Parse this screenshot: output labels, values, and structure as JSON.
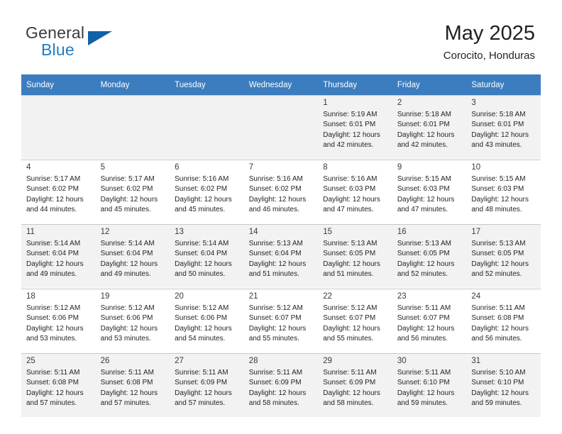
{
  "brand": {
    "line1": "General",
    "line2": "Blue",
    "triangle_icon": "brand-triangle-icon",
    "colors": {
      "general": "#3b3b3b",
      "blue": "#1f7dc4",
      "triangle": "#1061a8"
    }
  },
  "header": {
    "title": "May 2025",
    "subtitle": "Corocito, Honduras"
  },
  "theme": {
    "header_row_bg": "#3b7dbf",
    "header_row_text": "#ffffff",
    "shaded_cell_bg": "#f2f2f2",
    "cell_border": "#c8c8c8"
  },
  "calendar": {
    "weekday_headers": [
      "Sunday",
      "Monday",
      "Tuesday",
      "Wednesday",
      "Thursday",
      "Friday",
      "Saturday"
    ],
    "labels": {
      "sunrise": "Sunrise",
      "sunset": "Sunset",
      "daylight": "Daylight"
    },
    "weeks": [
      [
        {
          "day": "",
          "sunrise": "",
          "sunset": "",
          "daylight_l1": "",
          "daylight_l2": "",
          "empty": true
        },
        {
          "day": "",
          "sunrise": "",
          "sunset": "",
          "daylight_l1": "",
          "daylight_l2": "",
          "empty": true
        },
        {
          "day": "",
          "sunrise": "",
          "sunset": "",
          "daylight_l1": "",
          "daylight_l2": "",
          "empty": true
        },
        {
          "day": "",
          "sunrise": "",
          "sunset": "",
          "daylight_l1": "",
          "daylight_l2": "",
          "empty": true
        },
        {
          "day": "1",
          "sunrise": "Sunrise: 5:19 AM",
          "sunset": "Sunset: 6:01 PM",
          "daylight_l1": "Daylight: 12 hours",
          "daylight_l2": "and 42 minutes."
        },
        {
          "day": "2",
          "sunrise": "Sunrise: 5:18 AM",
          "sunset": "Sunset: 6:01 PM",
          "daylight_l1": "Daylight: 12 hours",
          "daylight_l2": "and 42 minutes."
        },
        {
          "day": "3",
          "sunrise": "Sunrise: 5:18 AM",
          "sunset": "Sunset: 6:01 PM",
          "daylight_l1": "Daylight: 12 hours",
          "daylight_l2": "and 43 minutes."
        }
      ],
      [
        {
          "day": "4",
          "sunrise": "Sunrise: 5:17 AM",
          "sunset": "Sunset: 6:02 PM",
          "daylight_l1": "Daylight: 12 hours",
          "daylight_l2": "and 44 minutes."
        },
        {
          "day": "5",
          "sunrise": "Sunrise: 5:17 AM",
          "sunset": "Sunset: 6:02 PM",
          "daylight_l1": "Daylight: 12 hours",
          "daylight_l2": "and 45 minutes."
        },
        {
          "day": "6",
          "sunrise": "Sunrise: 5:16 AM",
          "sunset": "Sunset: 6:02 PM",
          "daylight_l1": "Daylight: 12 hours",
          "daylight_l2": "and 45 minutes."
        },
        {
          "day": "7",
          "sunrise": "Sunrise: 5:16 AM",
          "sunset": "Sunset: 6:02 PM",
          "daylight_l1": "Daylight: 12 hours",
          "daylight_l2": "and 46 minutes."
        },
        {
          "day": "8",
          "sunrise": "Sunrise: 5:16 AM",
          "sunset": "Sunset: 6:03 PM",
          "daylight_l1": "Daylight: 12 hours",
          "daylight_l2": "and 47 minutes."
        },
        {
          "day": "9",
          "sunrise": "Sunrise: 5:15 AM",
          "sunset": "Sunset: 6:03 PM",
          "daylight_l1": "Daylight: 12 hours",
          "daylight_l2": "and 47 minutes."
        },
        {
          "day": "10",
          "sunrise": "Sunrise: 5:15 AM",
          "sunset": "Sunset: 6:03 PM",
          "daylight_l1": "Daylight: 12 hours",
          "daylight_l2": "and 48 minutes."
        }
      ],
      [
        {
          "day": "11",
          "sunrise": "Sunrise: 5:14 AM",
          "sunset": "Sunset: 6:04 PM",
          "daylight_l1": "Daylight: 12 hours",
          "daylight_l2": "and 49 minutes."
        },
        {
          "day": "12",
          "sunrise": "Sunrise: 5:14 AM",
          "sunset": "Sunset: 6:04 PM",
          "daylight_l1": "Daylight: 12 hours",
          "daylight_l2": "and 49 minutes."
        },
        {
          "day": "13",
          "sunrise": "Sunrise: 5:14 AM",
          "sunset": "Sunset: 6:04 PM",
          "daylight_l1": "Daylight: 12 hours",
          "daylight_l2": "and 50 minutes."
        },
        {
          "day": "14",
          "sunrise": "Sunrise: 5:13 AM",
          "sunset": "Sunset: 6:04 PM",
          "daylight_l1": "Daylight: 12 hours",
          "daylight_l2": "and 51 minutes."
        },
        {
          "day": "15",
          "sunrise": "Sunrise: 5:13 AM",
          "sunset": "Sunset: 6:05 PM",
          "daylight_l1": "Daylight: 12 hours",
          "daylight_l2": "and 51 minutes."
        },
        {
          "day": "16",
          "sunrise": "Sunrise: 5:13 AM",
          "sunset": "Sunset: 6:05 PM",
          "daylight_l1": "Daylight: 12 hours",
          "daylight_l2": "and 52 minutes."
        },
        {
          "day": "17",
          "sunrise": "Sunrise: 5:13 AM",
          "sunset": "Sunset: 6:05 PM",
          "daylight_l1": "Daylight: 12 hours",
          "daylight_l2": "and 52 minutes."
        }
      ],
      [
        {
          "day": "18",
          "sunrise": "Sunrise: 5:12 AM",
          "sunset": "Sunset: 6:06 PM",
          "daylight_l1": "Daylight: 12 hours",
          "daylight_l2": "and 53 minutes."
        },
        {
          "day": "19",
          "sunrise": "Sunrise: 5:12 AM",
          "sunset": "Sunset: 6:06 PM",
          "daylight_l1": "Daylight: 12 hours",
          "daylight_l2": "and 53 minutes."
        },
        {
          "day": "20",
          "sunrise": "Sunrise: 5:12 AM",
          "sunset": "Sunset: 6:06 PM",
          "daylight_l1": "Daylight: 12 hours",
          "daylight_l2": "and 54 minutes."
        },
        {
          "day": "21",
          "sunrise": "Sunrise: 5:12 AM",
          "sunset": "Sunset: 6:07 PM",
          "daylight_l1": "Daylight: 12 hours",
          "daylight_l2": "and 55 minutes."
        },
        {
          "day": "22",
          "sunrise": "Sunrise: 5:12 AM",
          "sunset": "Sunset: 6:07 PM",
          "daylight_l1": "Daylight: 12 hours",
          "daylight_l2": "and 55 minutes."
        },
        {
          "day": "23",
          "sunrise": "Sunrise: 5:11 AM",
          "sunset": "Sunset: 6:07 PM",
          "daylight_l1": "Daylight: 12 hours",
          "daylight_l2": "and 56 minutes."
        },
        {
          "day": "24",
          "sunrise": "Sunrise: 5:11 AM",
          "sunset": "Sunset: 6:08 PM",
          "daylight_l1": "Daylight: 12 hours",
          "daylight_l2": "and 56 minutes."
        }
      ],
      [
        {
          "day": "25",
          "sunrise": "Sunrise: 5:11 AM",
          "sunset": "Sunset: 6:08 PM",
          "daylight_l1": "Daylight: 12 hours",
          "daylight_l2": "and 57 minutes."
        },
        {
          "day": "26",
          "sunrise": "Sunrise: 5:11 AM",
          "sunset": "Sunset: 6:08 PM",
          "daylight_l1": "Daylight: 12 hours",
          "daylight_l2": "and 57 minutes."
        },
        {
          "day": "27",
          "sunrise": "Sunrise: 5:11 AM",
          "sunset": "Sunset: 6:09 PM",
          "daylight_l1": "Daylight: 12 hours",
          "daylight_l2": "and 57 minutes."
        },
        {
          "day": "28",
          "sunrise": "Sunrise: 5:11 AM",
          "sunset": "Sunset: 6:09 PM",
          "daylight_l1": "Daylight: 12 hours",
          "daylight_l2": "and 58 minutes."
        },
        {
          "day": "29",
          "sunrise": "Sunrise: 5:11 AM",
          "sunset": "Sunset: 6:09 PM",
          "daylight_l1": "Daylight: 12 hours",
          "daylight_l2": "and 58 minutes."
        },
        {
          "day": "30",
          "sunrise": "Sunrise: 5:11 AM",
          "sunset": "Sunset: 6:10 PM",
          "daylight_l1": "Daylight: 12 hours",
          "daylight_l2": "and 59 minutes."
        },
        {
          "day": "31",
          "sunrise": "Sunrise: 5:10 AM",
          "sunset": "Sunset: 6:10 PM",
          "daylight_l1": "Daylight: 12 hours",
          "daylight_l2": "and 59 minutes."
        }
      ]
    ]
  }
}
